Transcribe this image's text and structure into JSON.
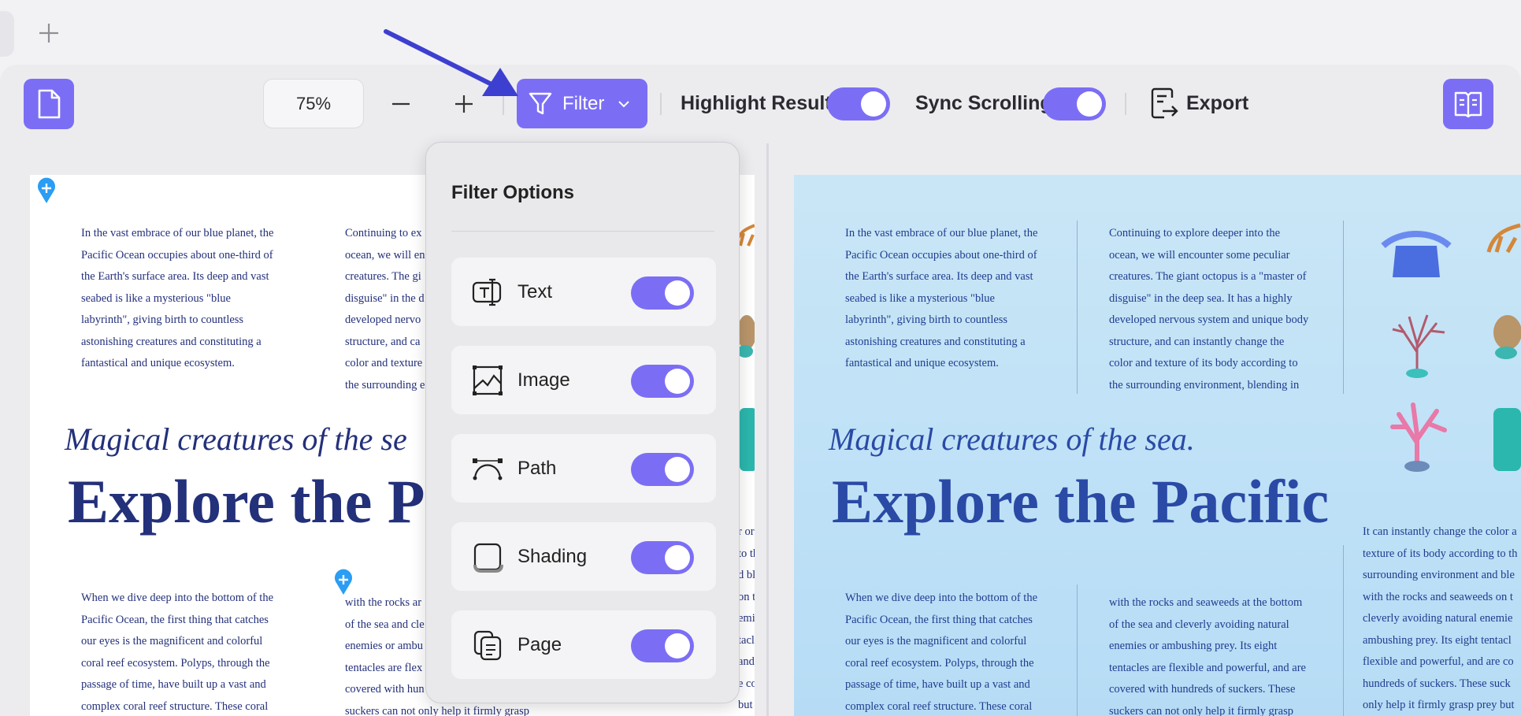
{
  "toolbar": {
    "zoom_value": "75%",
    "filter_label": "Filter",
    "highlight_label": "Highlight Result",
    "highlight_on": true,
    "sync_label": "Sync Scrolling",
    "sync_on": true,
    "export_label": "Export"
  },
  "filter_popup": {
    "title": "Filter Options",
    "options": [
      {
        "label": "Text",
        "icon": "text-icon",
        "enabled": true
      },
      {
        "label": "Image",
        "icon": "image-icon",
        "enabled": true
      },
      {
        "label": "Path",
        "icon": "path-icon",
        "enabled": true
      },
      {
        "label": "Shading",
        "icon": "shading-icon",
        "enabled": true
      },
      {
        "label": "Page",
        "icon": "page-icon",
        "enabled": true
      }
    ]
  },
  "left_doc": {
    "col1_top": [
      "In the vast embrace of our blue planet, the",
      "Pacific Ocean occupies about one-third of",
      "the Earth's surface area. Its deep and vast",
      "seabed is like a mysterious \"blue",
      "labyrinth\", giving birth to countless",
      "astonishing creatures and constituting a",
      "fantastical and unique ecosystem."
    ],
    "col2_top": [
      "Continuing to ex",
      "ocean, we will en",
      "creatures. The gi",
      "disguise\" in the d",
      "developed nervo",
      "structure, and ca",
      "color and texture",
      "the surrounding e"
    ],
    "subtitle": "Magical creatures of the se",
    "title": "Explore the P",
    "col1_bottom": [
      "When we dive deep into the bottom of the",
      "Pacific Ocean, the first thing that catches",
      "our eyes is the magnificent and colorful",
      "coral reef ecosystem. Polyps, through the",
      "passage of time, have built up a vast and",
      "complex coral reef structure. These coral"
    ],
    "col2_bottom": [
      "with the rocks ar",
      "of the sea and cle",
      "enemies or ambu",
      "tentacles are flex",
      "covered with hun",
      "suckers can not only help it firmly grasp"
    ],
    "col3_bottom": [
      "r or a",
      "to th",
      "d ble",
      "on th",
      "emie",
      "tacle",
      "and a",
      "e co",
      "but"
    ]
  },
  "right_doc": {
    "col1_top": [
      "In the vast embrace of our blue planet, the",
      "Pacific Ocean occupies about one-third of",
      "the Earth's surface area. Its deep and vast",
      "seabed is like a mysterious \"blue",
      "labyrinth\", giving birth to countless",
      "astonishing creatures and constituting a",
      "fantastical and unique ecosystem."
    ],
    "col2_top": [
      "Continuing to explore deeper into the",
      "ocean, we will encounter some peculiar",
      "creatures. The giant octopus is a \"master of",
      "disguise\" in the deep sea. It has a highly",
      "developed nervous system and unique body",
      "structure, and can instantly change the",
      "color and texture of its body according to",
      "the surrounding environment, blending in"
    ],
    "subtitle": "Magical creatures of the sea.",
    "title": "Explore the Pacific",
    "col1_bottom": [
      "When we dive deep into the bottom of the",
      "Pacific Ocean, the first thing that catches",
      "our eyes is the magnificent and colorful",
      "coral reef ecosystem. Polyps, through the",
      "passage of time, have built up a vast and",
      "complex coral reef structure. These coral"
    ],
    "col2_bottom": [
      "with the rocks and seaweeds at the bottom",
      "of the sea and cleverly avoiding natural",
      "enemies or ambushing prey. Its eight",
      "tentacles are flexible and powerful, and are",
      "covered with hundreds of suckers. These",
      "suckers can not only help it firmly grasp"
    ],
    "col3_bottom": [
      "It can instantly change the color a",
      "texture of its body according to th",
      "surrounding environment and ble",
      "with the rocks and seaweeds on t",
      "cleverly avoiding natural enemie",
      "ambushing prey. Its eight tentacl",
      "flexible and powerful, and are co",
      "hundreds of suckers. These suck",
      "only help it firmly grasp prey but"
    ]
  },
  "colors": {
    "accent": "#7b6ef5",
    "title_left": "#23307a",
    "title_right": "#2a4aa6",
    "arrow": "#3d3fd0"
  }
}
